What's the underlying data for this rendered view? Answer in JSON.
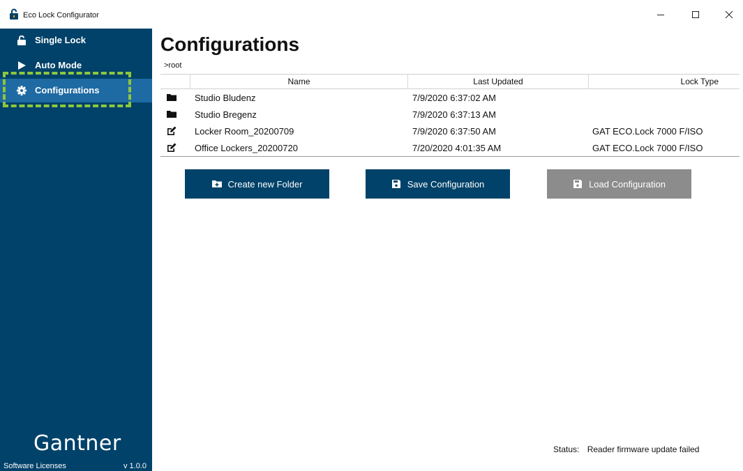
{
  "window": {
    "title": "Eco Lock Configurator"
  },
  "sidebar": {
    "items": [
      {
        "label": "Single Lock",
        "icon": "unlock-icon"
      },
      {
        "label": "Auto Mode",
        "icon": "play-icon"
      },
      {
        "label": "Configurations",
        "icon": "gear-icon",
        "selected": true
      }
    ],
    "brand": "Gantner",
    "licenses_label": "Software Licenses",
    "version": "v 1.0.0"
  },
  "main": {
    "title": "Configurations",
    "breadcrumb": ">root",
    "table": {
      "columns": [
        "Name",
        "Last Updated",
        "Lock Type"
      ],
      "rows": [
        {
          "icon": "folder-icon",
          "name": "Studio Bludenz",
          "updated": "7/9/2020 6:37:02 AM",
          "lock_type": ""
        },
        {
          "icon": "folder-icon",
          "name": "Studio Bregenz",
          "updated": "7/9/2020 6:37:13 AM",
          "lock_type": ""
        },
        {
          "icon": "edit-icon",
          "name": "Locker Room_20200709",
          "updated": "7/9/2020 6:37:50 AM",
          "lock_type": "GAT ECO.Lock 7000 F/ISO"
        },
        {
          "icon": "edit-icon",
          "name": "Office Lockers_20200720",
          "updated": "7/20/2020 4:01:35 AM",
          "lock_type": "GAT ECO.Lock 7000 F/ISO"
        }
      ]
    },
    "buttons": {
      "create_folder": "Create new Folder",
      "save_config": "Save Configuration",
      "load_config": "Load Configuration"
    }
  },
  "status": {
    "label": "Status:",
    "text": "Reader firmware update failed"
  },
  "colors": {
    "sidebar": "#004269",
    "selected": "#1e6aa3",
    "highlight": "#8dc63f",
    "disabled_button": "#8c8c8c"
  }
}
